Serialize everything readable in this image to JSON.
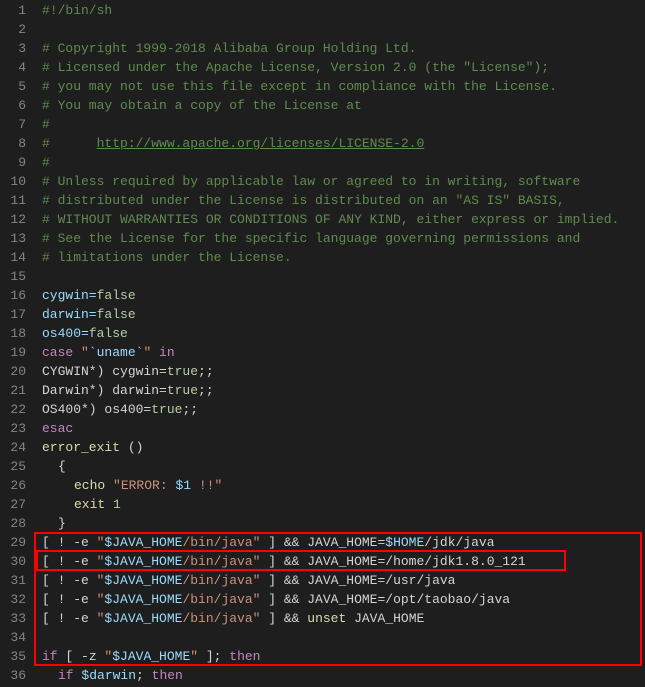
{
  "gutter": {
    "start": 1,
    "end": 36
  },
  "lines": {
    "l1": "#!/bin/sh",
    "l2": "",
    "l3": "# Copyright 1999-2018 Alibaba Group Holding Ltd.",
    "l4": "# Licensed under the Apache License, Version 2.0 (the \"License\");",
    "l5": "# you may not use this file except in compliance with the License.",
    "l6": "# You may obtain a copy of the License at",
    "l7": "#",
    "l8a": "#      ",
    "l8b": "http://www.apache.org/licenses/LICENSE-2.0",
    "l9": "#",
    "l10": "# Unless required by applicable law or agreed to in writing, software",
    "l11": "# distributed under the License is distributed on an \"AS IS\" BASIS,",
    "l12": "# WITHOUT WARRANTIES OR CONDITIONS OF ANY KIND, either express or implied.",
    "l13": "# See the License for the specific language governing permissions and",
    "l14": "# limitations under the License.",
    "l15": "",
    "l16a": "cygwin=",
    "l16b": "false",
    "l17a": "darwin=",
    "l17b": "false",
    "l18a": "os400=",
    "l18b": "false",
    "l19a": "case",
    "l19b": " \"",
    "l19c": "`uname`",
    "l19d": "\" ",
    "l19e": "in",
    "l20a": "CYGWIN*) cygwin=",
    "l20b": "true",
    "l20c": ";;",
    "l21a": "Darwin*) darwin=",
    "l21b": "true",
    "l21c": ";;",
    "l22a": "OS400*) os400=",
    "l22b": "true",
    "l22c": ";;",
    "l23": "esac",
    "l24a": "error_exit",
    "l24b": " ()",
    "l25": "{",
    "l26a": "echo",
    "l26b": " \"ERROR: ",
    "l26c": "$1",
    "l26d": " !!\"",
    "l27a": "exit",
    "l27b": " 1",
    "l28": "}",
    "l29a": "[ ! -e ",
    "l29b": "\"",
    "l29c": "$JAVA_HOME",
    "l29d": "/bin/java\"",
    "l29e": " ] && JAVA_HOME=",
    "l29f": "$HOME",
    "l29g": "/jdk/java",
    "l30a": "[ ! -e ",
    "l30b": "\"",
    "l30c": "$JAVA_HOME",
    "l30d": "/bin/java\"",
    "l30e": " ] && JAVA_HOME=/home/jdk1.8.0_121",
    "l31a": "[ ! -e ",
    "l31b": "\"",
    "l31c": "$JAVA_HOME",
    "l31d": "/bin/java\"",
    "l31e": " ] && JAVA_HOME=/usr/java",
    "l32a": "[ ! -e ",
    "l32b": "\"",
    "l32c": "$JAVA_HOME",
    "l32d": "/bin/java\"",
    "l32e": " ] && JAVA_HOME=/opt/taobao/java",
    "l33a": "[ ! -e ",
    "l33b": "\"",
    "l33c": "$JAVA_HOME",
    "l33d": "/bin/java\"",
    "l33e": " ] && ",
    "l33f": "unset",
    "l33g": " JAVA_HOME",
    "l34": "",
    "l35a": "if",
    "l35b": " [ -z ",
    "l35c": "\"",
    "l35d": "$JAVA_HOME",
    "l35e": "\"",
    "l35f": " ]; ",
    "l35g": "then",
    "l36a": "if",
    "l36b": " ",
    "l36c": "$darwin",
    "l36d": "; ",
    "l36e": "then"
  }
}
